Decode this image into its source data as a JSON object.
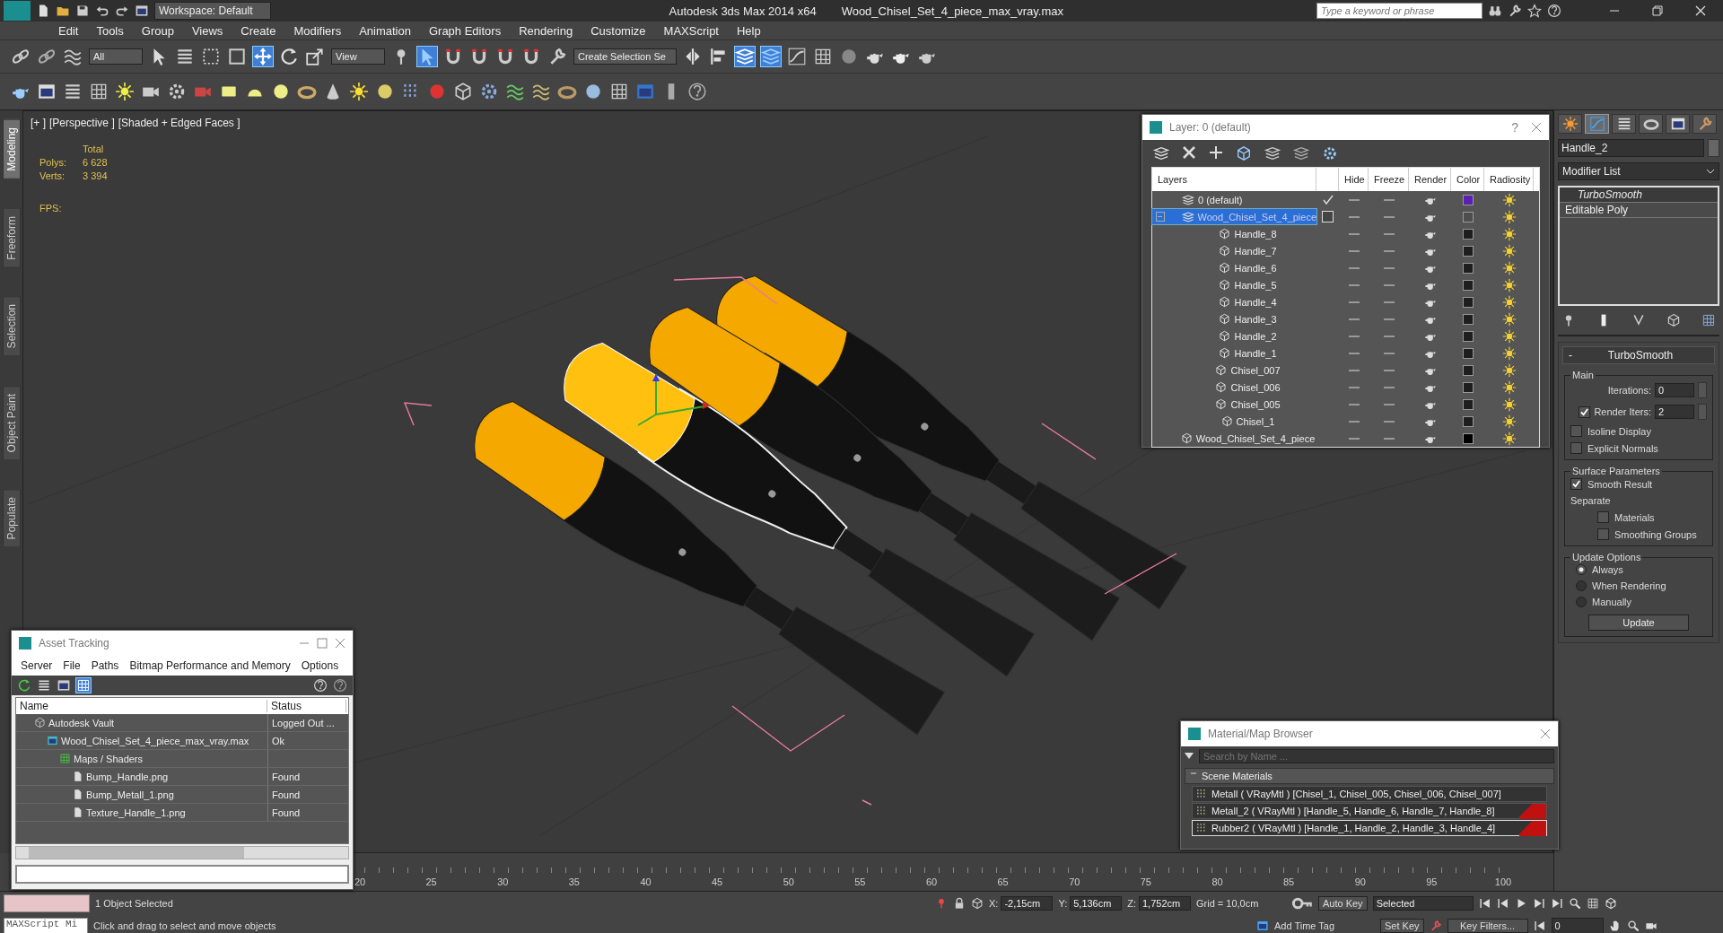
{
  "title_bar": {
    "workspace": "Workspace: Default",
    "app": "Autodesk 3ds Max  2014 x64",
    "file": "Wood_Chisel_Set_4_piece_max_vray.max",
    "search": {
      "placeholder": "Type a keyword or phrase"
    }
  },
  "menu": [
    "Edit",
    "Tools",
    "Group",
    "Views",
    "Create",
    "Modifiers",
    "Animation",
    "Graph Editors",
    "Rendering",
    "Customize",
    "MAXScript",
    "Help"
  ],
  "toolbar": {
    "selection_filter": "All",
    "reference_coord": "View",
    "named_selection": "Create Selection Se"
  },
  "ribbon_tabs": [
    {
      "label": "Modeling",
      "selected": true
    },
    {
      "label": "Freeform",
      "selected": false
    },
    {
      "label": "Selection",
      "selected": false
    },
    {
      "label": "Object Paint",
      "selected": false
    },
    {
      "label": "Populate",
      "selected": false
    }
  ],
  "viewport": {
    "labels": [
      "[+ ]",
      "[Perspective ]",
      "[Shaded + Edged Faces ]"
    ],
    "stats_header": "Total",
    "stats": [
      {
        "label": "Polys:",
        "value": "6 628"
      },
      {
        "label": "Verts:",
        "value": "3 394"
      }
    ],
    "fps": "FPS:"
  },
  "layer_dialog": {
    "title": "Layer: 0 (default)",
    "help": "?",
    "columns": [
      "Layers",
      "Hide",
      "Freeze",
      "Render",
      "Color",
      "Radiosity"
    ],
    "rows": [
      {
        "name": "0 (default)",
        "current": true,
        "selected": false,
        "expanded": false,
        "color": "#5a1fb0"
      },
      {
        "name": "Wood_Chisel_Set_4_piece",
        "current": false,
        "selected": true,
        "expanded": true,
        "color": "#4e4e4e",
        "children": [
          {
            "name": "Handle_8",
            "color": "#1e1e1e"
          },
          {
            "name": "Handle_7",
            "color": "#1e1e1e"
          },
          {
            "name": "Handle_6",
            "color": "#1e1e1e"
          },
          {
            "name": "Handle_5",
            "color": "#1e1e1e"
          },
          {
            "name": "Handle_4",
            "color": "#1e1e1e"
          },
          {
            "name": "Handle_3",
            "color": "#1e1e1e"
          },
          {
            "name": "Handle_2",
            "color": "#1e1e1e"
          },
          {
            "name": "Handle_1",
            "color": "#1e1e1e"
          },
          {
            "name": "Chisel_007",
            "color": "#1e1e1e"
          },
          {
            "name": "Chisel_006",
            "color": "#1e1e1e"
          },
          {
            "name": "Chisel_005",
            "color": "#1e1e1e"
          },
          {
            "name": "Chisel_1",
            "color": "#1e1e1e"
          },
          {
            "name": "Wood_Chisel_Set_4_piece",
            "color": "#000000"
          }
        ]
      }
    ]
  },
  "asset_tracking": {
    "title": "Asset Tracking",
    "menu": [
      "Server",
      "File",
      "Paths",
      "Bitmap Performance and Memory",
      "Options"
    ],
    "columns": [
      "Name",
      "Status"
    ],
    "rows": [
      {
        "name": "Autodesk Vault",
        "kind": "vault",
        "status": "Logged Out ...",
        "children": [
          {
            "name": "Wood_Chisel_Set_4_piece_max_vray.max",
            "kind": "scene",
            "status": "Ok",
            "children": [
              {
                "name": "Maps / Shaders",
                "kind": "folder",
                "children": [
                  {
                    "name": "Bump_Handle.png",
                    "kind": "image",
                    "status": "Found"
                  },
                  {
                    "name": "Bump_Metall_1.png",
                    "kind": "image",
                    "status": "Found"
                  },
                  {
                    "name": "Texture_Handle_1.png",
                    "kind": "image",
                    "status": "Found"
                  }
                ]
              }
            ]
          }
        ]
      }
    ]
  },
  "material_browser": {
    "title": "Material/Map Browser",
    "search": {
      "placeholder": "Search by Name ..."
    },
    "group": {
      "label": "Scene Materials",
      "expanded": true
    },
    "items": [
      {
        "label": "Metall  ( VRayMtl )  [Chisel_1, Chisel_005, Chisel_006, Chisel_007]",
        "selected": false,
        "flagged": false
      },
      {
        "label": "Metall_2  ( VRayMtl )  [Handle_5, Handle_6, Handle_7, Handle_8]",
        "selected": false,
        "flagged": true
      },
      {
        "label": "Rubber2  ( VRayMtl )  [Handle_1, Handle_2, Handle_3, Handle_4]",
        "selected": true,
        "flagged": true
      }
    ]
  },
  "command_panel": {
    "tabs": [
      {
        "kind": "create",
        "selected": false
      },
      {
        "kind": "modify",
        "selected": true
      },
      {
        "kind": "hierarchy",
        "selected": false
      },
      {
        "kind": "motion",
        "selected": false
      },
      {
        "kind": "display",
        "selected": false
      },
      {
        "kind": "utilities",
        "selected": false
      }
    ],
    "object_name": "Handle_2",
    "modifier_list": "Modifier List",
    "stack": [
      {
        "label": "TurboSmooth",
        "kind": "modifier"
      },
      {
        "label": "Editable Poly",
        "kind": "base"
      }
    ],
    "rollout": {
      "title": "TurboSmooth",
      "collapse": "-",
      "main": {
        "title": "Main",
        "iterations": {
          "label": "Iterations:",
          "value": "0"
        },
        "render_iters": {
          "label": "Render Iters:",
          "value": "2",
          "checked": true
        },
        "options": [
          {
            "label": "Isoline Display",
            "checked": false
          },
          {
            "label": "Explicit Normals",
            "checked": false
          }
        ]
      },
      "surface": {
        "title": "Surface Parameters",
        "smooth_result": {
          "label": "Smooth Result",
          "checked": true
        },
        "separate": "Separate",
        "options": [
          {
            "label": "Materials",
            "checked": false
          },
          {
            "label": "Smoothing Groups",
            "checked": false
          }
        ]
      },
      "update": {
        "title": "Update Options",
        "options": [
          {
            "label": "Always",
            "selected": true
          },
          {
            "label": "When Rendering",
            "selected": false
          },
          {
            "label": "Manually",
            "selected": false
          }
        ],
        "button": "Update"
      }
    }
  },
  "timeline": {
    "ticks": [
      "20",
      "25",
      "30",
      "35",
      "40",
      "45",
      "50",
      "55",
      "60",
      "65",
      "70",
      "75",
      "80",
      "85",
      "90",
      "95",
      "100"
    ]
  },
  "status_bar": {
    "maxscript": "MAXScript Mi",
    "selection": "1 Object Selected",
    "prompt": "Click and drag to select and move objects",
    "coords": [
      {
        "axis": "X:",
        "value": "-2,15cm"
      },
      {
        "axis": "Y:",
        "value": "5,136cm"
      },
      {
        "axis": "Z:",
        "value": "1,752cm"
      }
    ],
    "grid": "Grid = 10,0cm",
    "add_time_tag": "Add Time Tag",
    "auto_key": "Auto Key",
    "key_mode": "Selected",
    "set_key": "Set Key",
    "key_filters": "Key Filters...",
    "frame": "0"
  }
}
